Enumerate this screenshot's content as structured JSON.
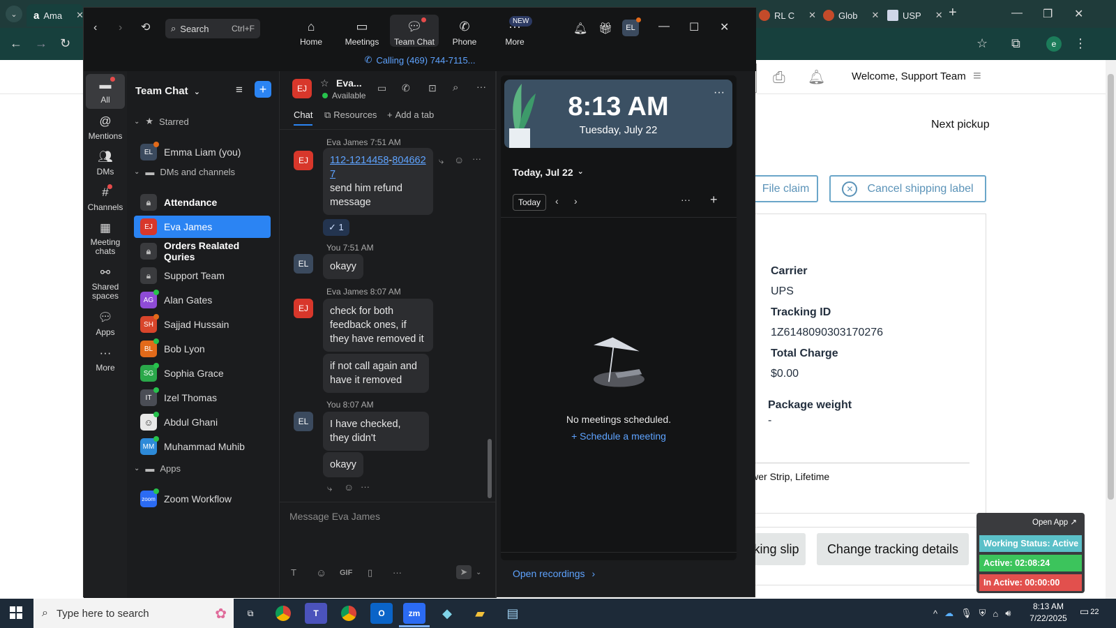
{
  "browser": {
    "tabs": [
      {
        "label": "Ama",
        "color": "#232f3e"
      },
      {
        "label": "RL C",
        "color": "#c44b2a"
      },
      {
        "label": "Glob",
        "color": "#d1502a"
      },
      {
        "label": "USP",
        "color": "#3a3a6a"
      }
    ],
    "profile_initial": "e"
  },
  "page": {
    "welcome": "Welcome, Support Team",
    "next_pickup": "Next pickup",
    "file_claim": "File claim",
    "cancel_label": "Cancel shipping label",
    "carrier_label": "Carrier",
    "carrier_value": "UPS",
    "tracking_label": "Tracking ID",
    "tracking_value": "1Z6148090303170276",
    "charge_label": "Total Charge",
    "charge_value": "$0.00",
    "weight_label": "Package weight",
    "weight_value": "-",
    "item_desc": "Power Strip, Lifetime",
    "slip_btn": "cking slip",
    "change_tracking": "Change tracking details"
  },
  "zoom": {
    "search_label": "Search",
    "search_shortcut": "Ctrl+F",
    "nav": [
      {
        "label": "Home"
      },
      {
        "label": "Meetings"
      },
      {
        "label": "Team Chat"
      },
      {
        "label": "Phone"
      },
      {
        "label": "More"
      }
    ],
    "new_badge": "NEW",
    "user_initials": "EL",
    "calling_text": "Calling (469) 744-7115...",
    "rail": [
      {
        "label": "All"
      },
      {
        "label": "Mentions"
      },
      {
        "label": "DMs"
      },
      {
        "label": "Channels"
      },
      {
        "label": "Meeting chats"
      },
      {
        "label": "Shared spaces"
      },
      {
        "label": "Apps"
      },
      {
        "label": "More"
      }
    ],
    "list_title": "Team Chat",
    "sections": {
      "starred": "Starred",
      "dms": "DMs and channels",
      "apps": "Apps"
    },
    "starred_items": [
      {
        "initials": "EL",
        "name": "Emma Liam (you)",
        "color": "#3b4a5e"
      }
    ],
    "dm_items": [
      {
        "type": "lock",
        "name": "Attendance",
        "bold": true
      },
      {
        "type": "avatar",
        "initials": "EJ",
        "name": "Eva James",
        "color": "#d8372b",
        "active": true
      },
      {
        "type": "lock",
        "name": "Orders Realated Quries",
        "bold": true
      },
      {
        "type": "lock",
        "name": "Support Team"
      },
      {
        "type": "avatar",
        "initials": "AG",
        "name": "Alan Gates",
        "color": "#8e4bd6"
      },
      {
        "type": "avatar",
        "initials": "SH",
        "name": "Sajjad Hussain",
        "color": "#d8452b"
      },
      {
        "type": "avatar",
        "initials": "BL",
        "name": "Bob Lyon",
        "color": "#e26a1a"
      },
      {
        "type": "avatar",
        "initials": "SG",
        "name": "Sophia Grace",
        "color": "#2aa84a"
      },
      {
        "type": "avatar",
        "initials": "IT",
        "name": "Izel Thomas",
        "color": "#4a4d55"
      },
      {
        "type": "avatar",
        "initials": "",
        "name": "Abdul Ghani",
        "color": "#e8e8e8"
      },
      {
        "type": "avatar",
        "initials": "MM",
        "name": "Muhammad Muhib",
        "color": "#2d8ad8"
      }
    ],
    "app_items": [
      {
        "initials": "zoom",
        "name": "Zoom Workflow",
        "color": "#2b6bf3"
      }
    ],
    "chat": {
      "contact_name": "Eva...",
      "contact_initials": "EJ",
      "status": "Available",
      "tabs": [
        "Chat",
        "Resources",
        "Add a tab"
      ],
      "messages": [
        {
          "meta": "Eva James 7:51 AM"
        },
        {
          "meta": "You 7:51 AM",
          "text": "okayy"
        },
        {
          "meta": "Eva James 8:07 AM",
          "text": "check for both feedback ones, if they have removed it",
          "text2": "if not call again and have it removed"
        },
        {
          "meta": "You 8:07 AM",
          "text": "I have checked, they didn't",
          "text2": "okayy"
        }
      ],
      "first_msg_link1": "112-1214458",
      "first_msg_link2": "8046627",
      "first_msg_text": "send him refund message",
      "reaction": "✓ 1",
      "composer_placeholder": "Message Eva James",
      "gif_label": "GIF"
    },
    "calendar": {
      "time": "8:13 AM",
      "date": "Tuesday, July 22",
      "today_header": "Today, Jul 22",
      "today_btn": "Today",
      "empty_text": "No meetings scheduled.",
      "schedule_link": "Schedule a meeting",
      "recordings_link": "Open recordings"
    }
  },
  "status_widget": {
    "open_app": "Open App ↗",
    "working": "Working Status: Active",
    "active": "Active: 02:08:24",
    "inactive": "In Active: 00:00:00",
    "colors": {
      "working": "#5bc0c8",
      "active": "#3cc45c",
      "inactive": "#e2504d"
    }
  },
  "taskbar": {
    "search_placeholder": "Type here to search",
    "time": "8:13 AM",
    "date": "7/22/2025",
    "notif_count": "22"
  }
}
